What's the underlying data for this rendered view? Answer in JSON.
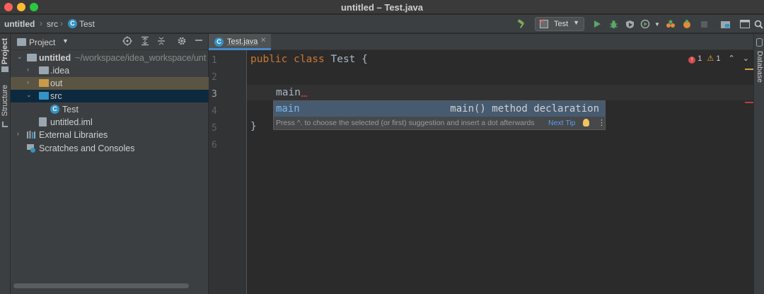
{
  "window": {
    "title": "untitled – Test.java"
  },
  "navbar": {
    "crumbs": [
      "untitled",
      "src",
      "Test"
    ],
    "run_config": "Test",
    "icons": [
      "hammer-icon",
      "run-icon",
      "debug-icon",
      "coverage-icon",
      "profile-icon",
      "attach-icon",
      "rerun-icon",
      "stop-icon",
      "project-structure-icon",
      "terminal-icon",
      "search-icon"
    ]
  },
  "left_strip": {
    "project_tab": "Project",
    "structure_tab": "Structure"
  },
  "project_panel": {
    "title": "Project",
    "tree": [
      {
        "label": "untitled",
        "path": "~/workspace/idea_workspace/unt",
        "bold": true
      },
      {
        "label": ".idea"
      },
      {
        "label": "out"
      },
      {
        "label": "src"
      },
      {
        "label": "Test"
      },
      {
        "label": "untitled.iml"
      },
      {
        "label": "External Libraries"
      },
      {
        "label": "Scratches and Consoles"
      }
    ]
  },
  "editor": {
    "tab_label": "Test.java",
    "line_numbers": [
      "1",
      "2",
      "3",
      "4",
      "5",
      "6"
    ],
    "code": {
      "line1_kw": "public class",
      "line1_rest": " Test {",
      "line3": "main",
      "line5": "}"
    },
    "indicators": {
      "errors": "1",
      "warnings": "1"
    }
  },
  "completion": {
    "item_name": "main",
    "item_desc": "main() method declaration",
    "hint": "Press ^. to choose the selected (or first) suggestion and insert a dot afterwards",
    "next_tip": "Next Tip"
  },
  "right_strip": {
    "database_tab": "Database"
  },
  "colors": {
    "accent": "#4a88c7",
    "keyword": "#cc7832",
    "text": "#a9b7c6",
    "error": "#bc3f3c"
  }
}
